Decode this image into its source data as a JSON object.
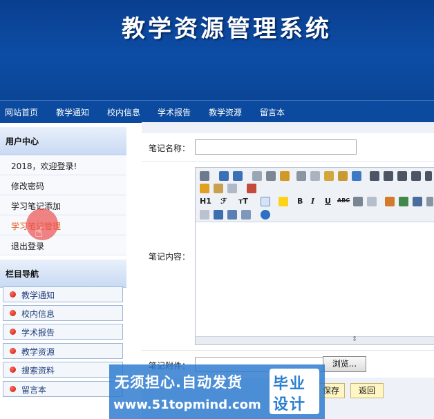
{
  "header": {
    "title": "教学资源管理系统"
  },
  "nav": [
    "网站首页",
    "教学通知",
    "校内信息",
    "学术报告",
    "教学资源",
    "留言本"
  ],
  "user_center": {
    "title": "用户中心",
    "items": [
      "2018，欢迎登录!",
      "修改密码",
      "学习笔记添加",
      "学习笔记管理",
      "退出登录"
    ],
    "active_index": 3
  },
  "column_nav": {
    "title": "栏目导航",
    "items": [
      "教学通知",
      "校内信息",
      "学术报告",
      "教学资源",
      "搜索资料",
      "留言本"
    ]
  },
  "form": {
    "name_label": "笔记名称：",
    "name_value": "",
    "content_label": "笔记内容：",
    "attachment_label": "笔记附件：",
    "browse_label": "浏览...",
    "save_label": "保存",
    "back_label": "返回"
  },
  "editor_toolbar": {
    "heading": "H1",
    "font": "ℱ",
    "size": "тT",
    "bold": "B",
    "italic": "I",
    "underline": "U",
    "strike": "ABC"
  },
  "watermark": {
    "line1": "无须担心.自动发货",
    "line2": "www.51topmind.com",
    "badge_top": "毕业",
    "badge_bottom": "设计"
  },
  "colors": {
    "banner": "#0b4a9e",
    "active_menu": "#e25b1c",
    "nav_dot": "#d1200f"
  }
}
